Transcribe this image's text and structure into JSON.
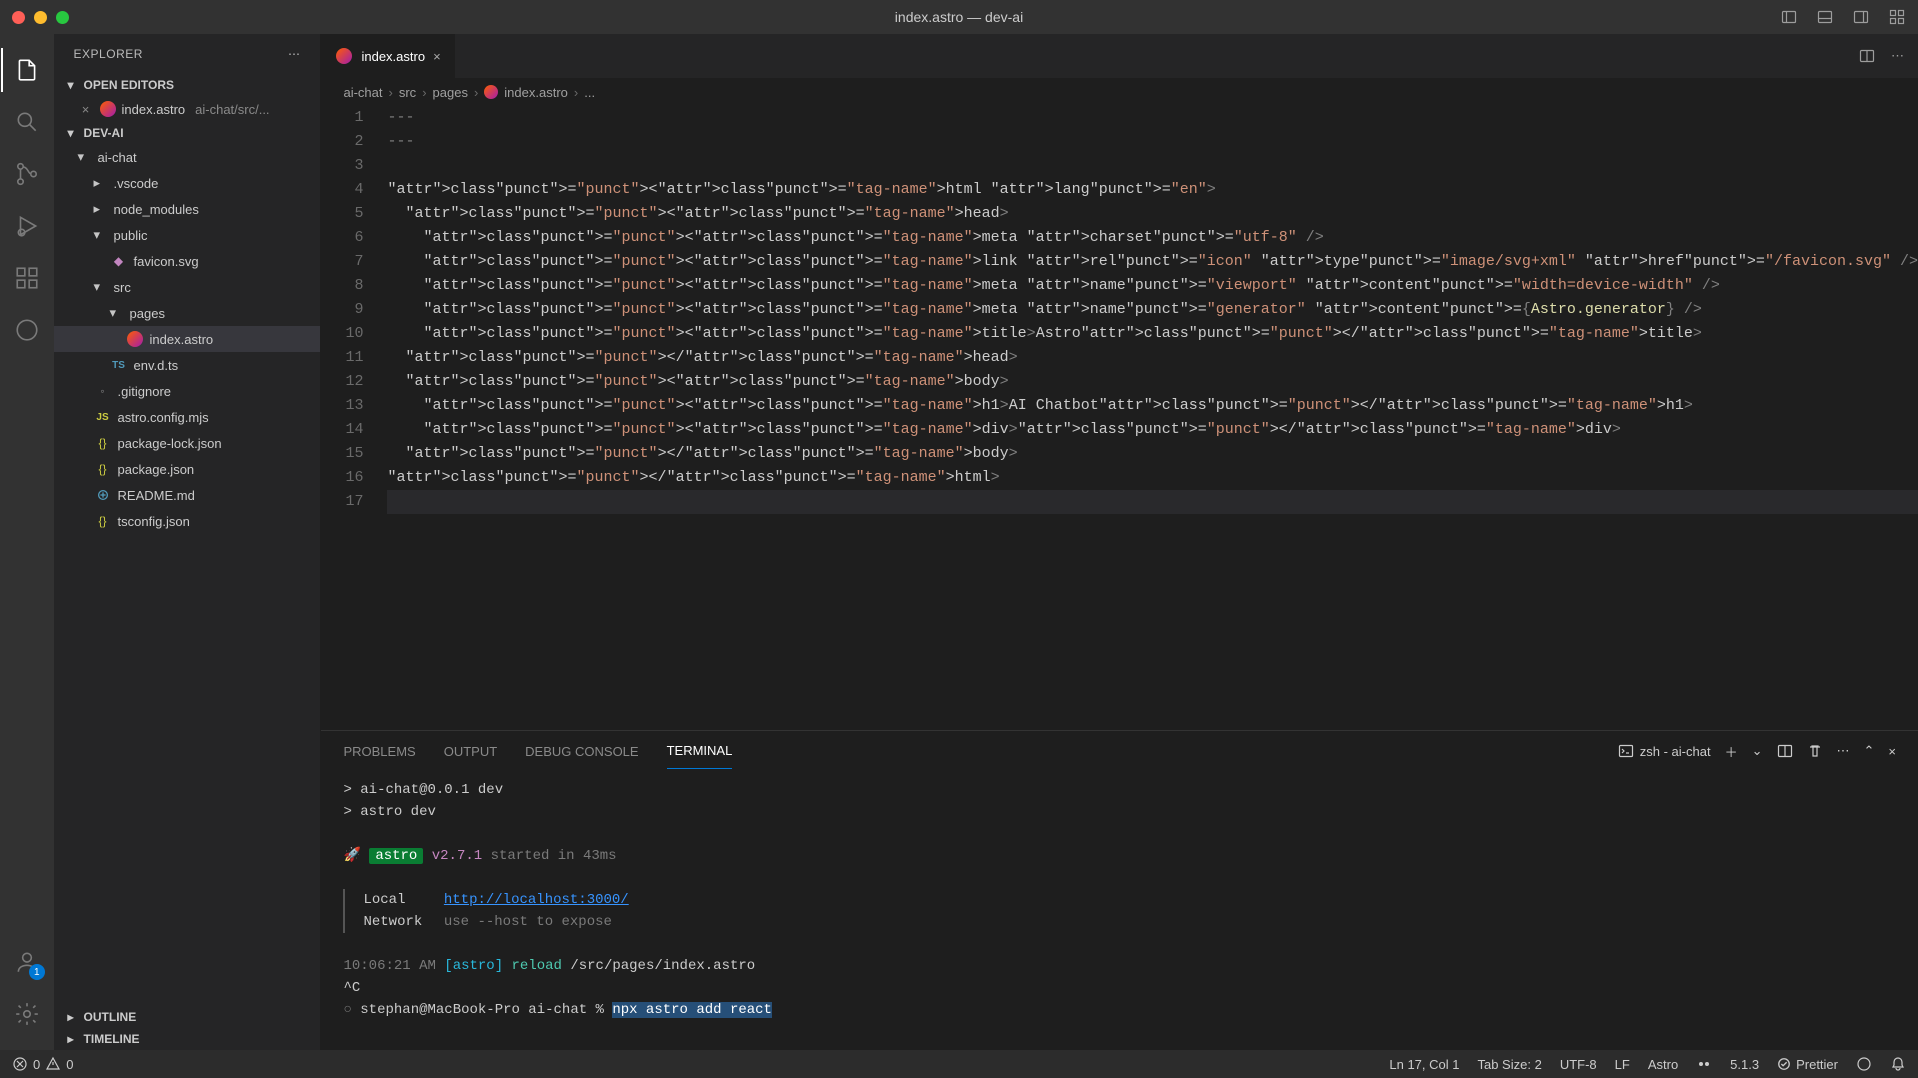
{
  "window_title": "index.astro — dev-ai",
  "explorer": {
    "title": "EXPLORER",
    "sections": {
      "open_editors": "OPEN EDITORS",
      "project": "DEV-AI",
      "outline": "OUTLINE",
      "timeline": "TIMELINE"
    },
    "open_editor": {
      "name": "index.astro",
      "hint": "ai-chat/src/..."
    },
    "tree": [
      {
        "label": "ai-chat",
        "type": "folder",
        "indent": 1,
        "open": true
      },
      {
        "label": ".vscode",
        "type": "folder",
        "indent": 2
      },
      {
        "label": "node_modules",
        "type": "folder",
        "indent": 2
      },
      {
        "label": "public",
        "type": "folder",
        "indent": 2,
        "open": true
      },
      {
        "label": "favicon.svg",
        "type": "file",
        "icon": "svg",
        "indent": 3
      },
      {
        "label": "src",
        "type": "folder",
        "indent": 2,
        "open": true
      },
      {
        "label": "pages",
        "type": "folder",
        "indent": 3,
        "open": true
      },
      {
        "label": "index.astro",
        "type": "file",
        "icon": "astro",
        "indent": 4,
        "selected": true
      },
      {
        "label": "env.d.ts",
        "type": "file",
        "icon": "ts",
        "indent": 3
      },
      {
        "label": ".gitignore",
        "type": "file",
        "icon": "git",
        "indent": 2
      },
      {
        "label": "astro.config.mjs",
        "type": "file",
        "icon": "js",
        "indent": 2
      },
      {
        "label": "package-lock.json",
        "type": "file",
        "icon": "json",
        "indent": 2
      },
      {
        "label": "package.json",
        "type": "file",
        "icon": "json",
        "indent": 2
      },
      {
        "label": "README.md",
        "type": "file",
        "icon": "md",
        "indent": 2
      },
      {
        "label": "tsconfig.json",
        "type": "file",
        "icon": "json",
        "indent": 2
      }
    ]
  },
  "tab": {
    "name": "index.astro"
  },
  "breadcrumbs": [
    "ai-chat",
    "src",
    "pages",
    "index.astro",
    "..."
  ],
  "code": {
    "lines": 17,
    "content": [
      "---",
      "---",
      "",
      "<html lang=\"en\">",
      "  <head>",
      "    <meta charset=\"utf-8\" />",
      "    <link rel=\"icon\" type=\"image/svg+xml\" href=\"/favicon.svg\" />",
      "    <meta name=\"viewport\" content=\"width=device-width\" />",
      "    <meta name=\"generator\" content={Astro.generator} />",
      "    <title>Astro</title>",
      "  </head>",
      "  <body>",
      "    <h1>AI Chatbot</h1>",
      "    <div></div>",
      "  </body>",
      "</html>",
      ""
    ]
  },
  "panel": {
    "tabs": [
      "PROBLEMS",
      "OUTPUT",
      "DEBUG CONSOLE",
      "TERMINAL"
    ],
    "active_tab": "TERMINAL",
    "shell": "zsh - ai-chat",
    "terminal": {
      "lines": [
        "> ai-chat@0.0.1 dev",
        "> astro dev",
        "",
        "🚀 astro v2.7.1 started in 43ms",
        "",
        "Local    http://localhost:3000/",
        "Network  use --host to expose",
        "",
        "10:06:21 AM [astro] reload /src/pages/index.astro",
        "^C",
        "stephan@MacBook-Pro ai-chat % npx astro add react"
      ],
      "astro_badge": "astro",
      "version": "v2.7.1",
      "started": "started in 43ms",
      "local_label": "Local",
      "local_url": "http://localhost:3000/",
      "network_label": "Network",
      "network_hint": "use --host to expose",
      "log_time": "10:06:21 AM",
      "log_tag": "[astro]",
      "log_cmd": "reload",
      "log_path": "/src/pages/index.astro",
      "interrupt": "^C",
      "prompt": "stephan@MacBook-Pro ai-chat %",
      "input": "npx astro add react",
      "dev_line1": "> ai-chat@0.0.1 dev",
      "dev_line2": "> astro dev"
    }
  },
  "statusbar": {
    "errors": "0",
    "warnings": "0",
    "cursor": "Ln 17, Col 1",
    "tab_size": "Tab Size: 2",
    "encoding": "UTF-8",
    "eol": "LF",
    "lang": "Astro",
    "version": "5.1.3",
    "prettier": "Prettier"
  },
  "account_badge": "1"
}
